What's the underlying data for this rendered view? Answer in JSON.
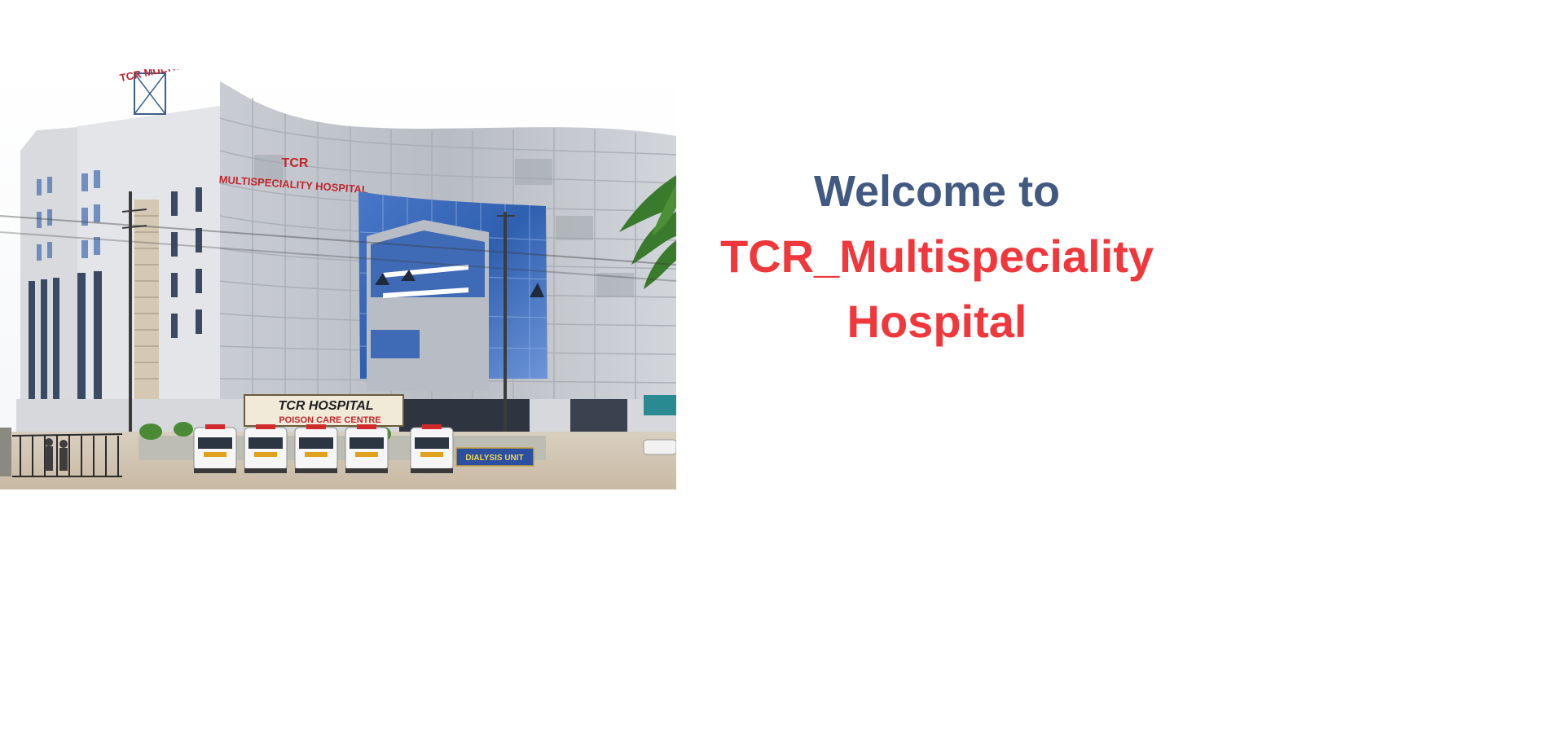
{
  "hero": {
    "image_icon": "hospital-building-photo",
    "building_sign_line1": "TCR",
    "building_sign_line2": "MULTISPECIALITY HOSPITAL",
    "entrance_sign_line1": "TCR HOSPITAL",
    "entrance_sign_line2": "POISON CARE CENTRE",
    "tower_sign": "TCR MULTISPECIALITY HOSPITAL",
    "dialysis_sign": "DIALYSIS UNIT"
  },
  "welcome": {
    "greeting": "Welcome to",
    "hospital_name_line1": "TCR_Multispeciality",
    "hospital_name_line2": "Hospital"
  },
  "colors": {
    "greeting": "#425a82",
    "hospital_name": "#f0383c",
    "background": "#ffffff"
  }
}
